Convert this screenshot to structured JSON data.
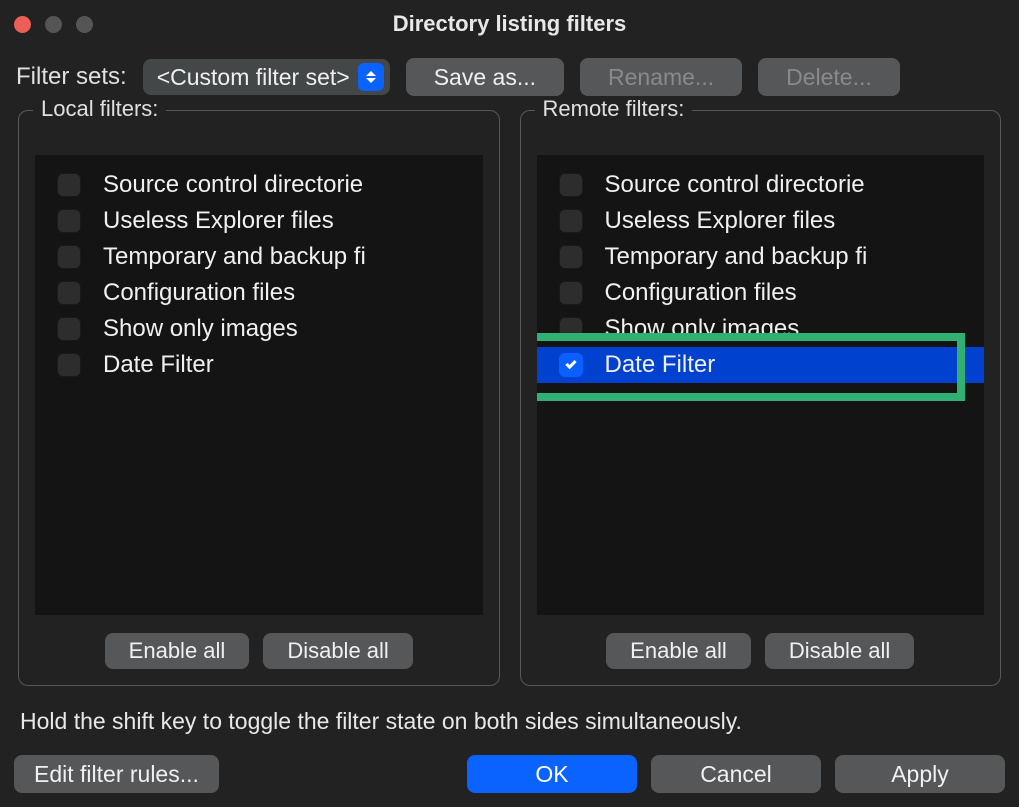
{
  "window": {
    "title": "Directory listing filters"
  },
  "toolbar": {
    "filter_sets_label": "Filter sets:",
    "filter_set_selected": "<Custom filter set>",
    "save_as_label": "Save as...",
    "rename_label": "Rename...",
    "delete_label": "Delete..."
  },
  "local": {
    "legend": "Local filters:",
    "items": [
      {
        "label": "Source control directorie",
        "checked": false,
        "selected": false
      },
      {
        "label": "Useless Explorer files",
        "checked": false,
        "selected": false
      },
      {
        "label": "Temporary and backup fi",
        "checked": false,
        "selected": false
      },
      {
        "label": "Configuration files",
        "checked": false,
        "selected": false
      },
      {
        "label": "Show only images",
        "checked": false,
        "selected": false
      },
      {
        "label": "Date Filter",
        "checked": false,
        "selected": false
      }
    ],
    "enable_all_label": "Enable all",
    "disable_all_label": "Disable all"
  },
  "remote": {
    "legend": "Remote filters:",
    "items": [
      {
        "label": "Source control directorie",
        "checked": false,
        "selected": false
      },
      {
        "label": "Useless Explorer files",
        "checked": false,
        "selected": false
      },
      {
        "label": "Temporary and backup fi",
        "checked": false,
        "selected": false
      },
      {
        "label": "Configuration files",
        "checked": false,
        "selected": false
      },
      {
        "label": "Show only images",
        "checked": false,
        "selected": false
      },
      {
        "label": "Date Filter",
        "checked": true,
        "selected": true
      }
    ],
    "enable_all_label": "Enable all",
    "disable_all_label": "Disable all"
  },
  "hint": "Hold the shift key to toggle the filter state on both sides simultaneously.",
  "bottom": {
    "edit_rules_label": "Edit filter rules...",
    "ok_label": "OK",
    "cancel_label": "Cancel",
    "apply_label": "Apply"
  }
}
